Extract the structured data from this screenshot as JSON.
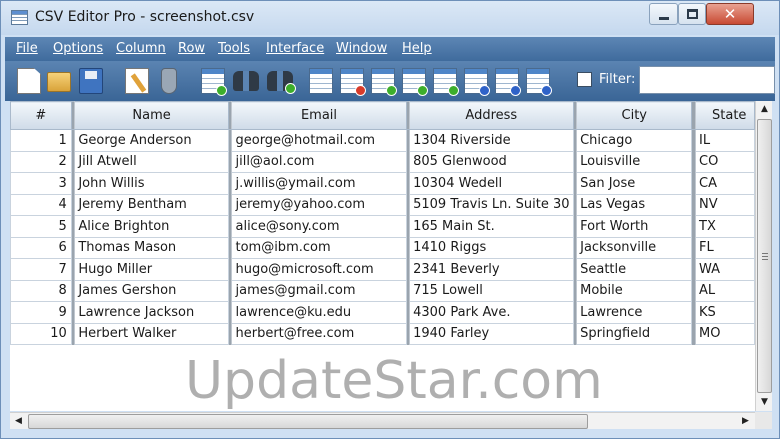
{
  "window": {
    "title": "CSV Editor Pro - screenshot.csv",
    "close_glyph": "✕"
  },
  "menu": [
    "File",
    "Options",
    "Column",
    "Row",
    "Tools",
    "Interface",
    "Window",
    "Help"
  ],
  "toolbar": {
    "icons": [
      "new-file-icon",
      "open-folder-icon",
      "save-disk-icon",
      "edit-icon",
      "flask-icon",
      "add-grid-icon",
      "find-binoculars-icon",
      "find-next-binoculars-icon",
      "insert-column-icon",
      "delete-column-icon",
      "add-column-icon",
      "add-row-icon",
      "move-left-icon",
      "move-down-icon",
      "move-up-icon",
      "sort-icon"
    ],
    "filter_label": "Filter:",
    "filter_value": ""
  },
  "grid": {
    "headers": [
      "#",
      "Name",
      "Email",
      "Address",
      "City",
      "State"
    ],
    "rows": [
      [
        "1",
        "George Anderson",
        "george@hotmail.com",
        "1304 Riverside",
        "Chicago",
        "IL"
      ],
      [
        "2",
        "Jill Atwell",
        "jill@aol.com",
        "805 Glenwood",
        "Louisville",
        "CO"
      ],
      [
        "3",
        "John Willis",
        "j.willis@ymail.com",
        "10304 Wedell",
        "San Jose",
        "CA"
      ],
      [
        "4",
        "Jeremy Bentham",
        "jeremy@yahoo.com",
        "5109 Travis Ln. Suite 30",
        "Las Vegas",
        "NV"
      ],
      [
        "5",
        "Alice Brighton",
        "alice@sony.com",
        "165 Main St.",
        "Fort Worth",
        "TX"
      ],
      [
        "6",
        "Thomas Mason",
        "tom@ibm.com",
        "1410 Riggs",
        "Jacksonville",
        "FL"
      ],
      [
        "7",
        "Hugo Miller",
        "hugo@microsoft.com",
        "2341 Beverly",
        "Seattle",
        "WA"
      ],
      [
        "8",
        "James Gershon",
        "james@gmail.com",
        "715 Lowell",
        "Mobile",
        "AL"
      ],
      [
        "9",
        "Lawrence Jackson",
        "lawrence@ku.edu",
        "4300 Park Ave.",
        "Lawrence",
        "KS"
      ],
      [
        "10",
        "Herbert Walker",
        "herbert@free.com",
        "1940 Farley",
        "Springfield",
        "MO"
      ]
    ]
  },
  "scroll": {
    "up": "▲",
    "down": "▼",
    "left": "◀",
    "right": "▶"
  },
  "watermark": "UpdateStar.com",
  "colors": {
    "menubar": "#4a76a8",
    "column_separator": "#9aa4ae"
  }
}
